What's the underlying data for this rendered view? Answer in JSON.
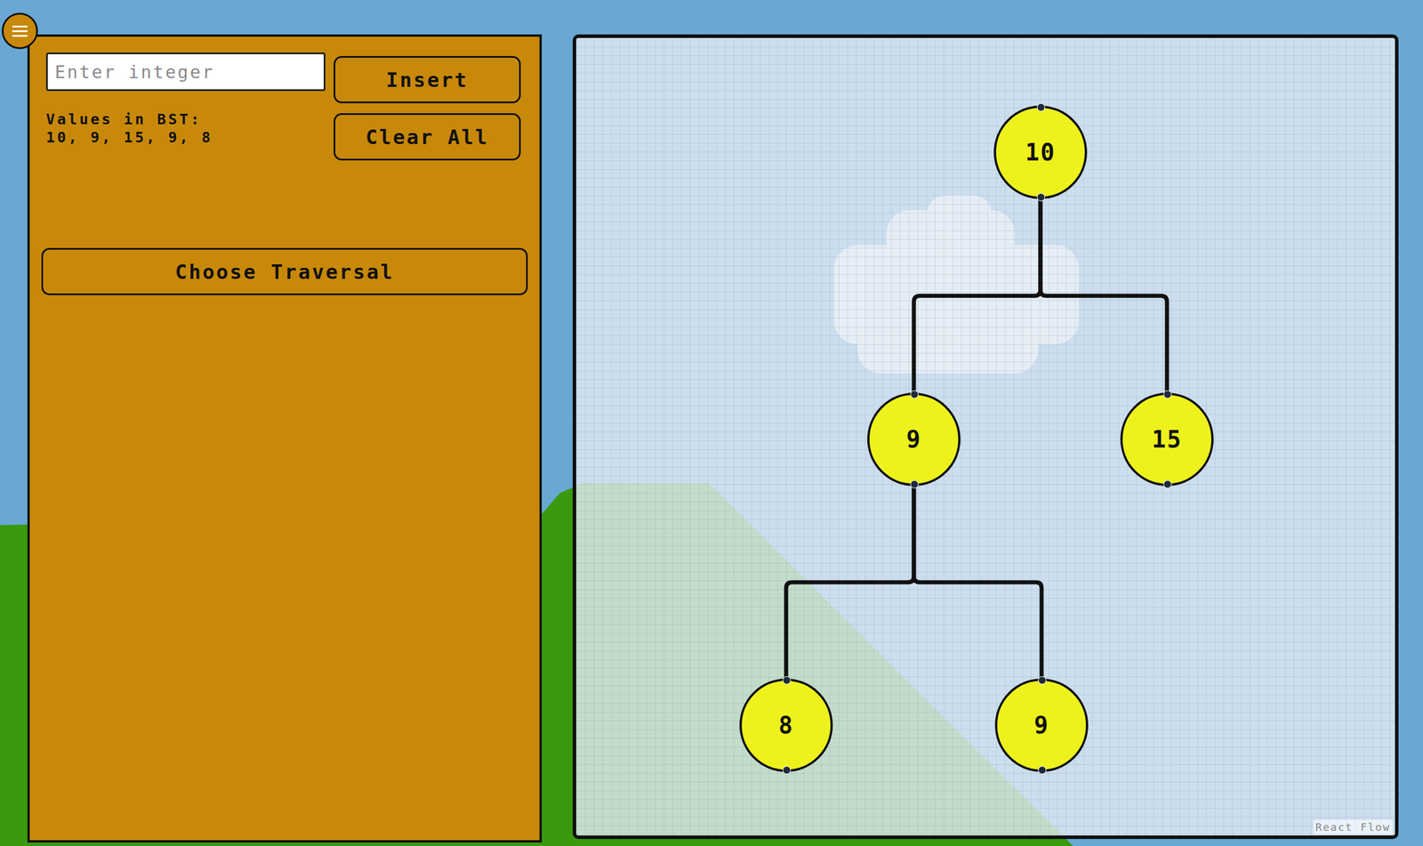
{
  "controls": {
    "input": {
      "placeholder": "Enter integer"
    },
    "buttons": [
      {
        "label": "Insert"
      },
      {
        "label": "Clear All"
      }
    ],
    "values_label": "Values in BST:",
    "values": "10, 9, 15, 9, 8",
    "traversal_button": "Choose Traversal"
  },
  "tree": {
    "value": "10",
    "left": {
      "value": "9",
      "left": {
        "value": "8"
      },
      "right": {
        "value": "9"
      }
    },
    "right": {
      "value": "15"
    }
  },
  "attribution": "React Flow"
}
